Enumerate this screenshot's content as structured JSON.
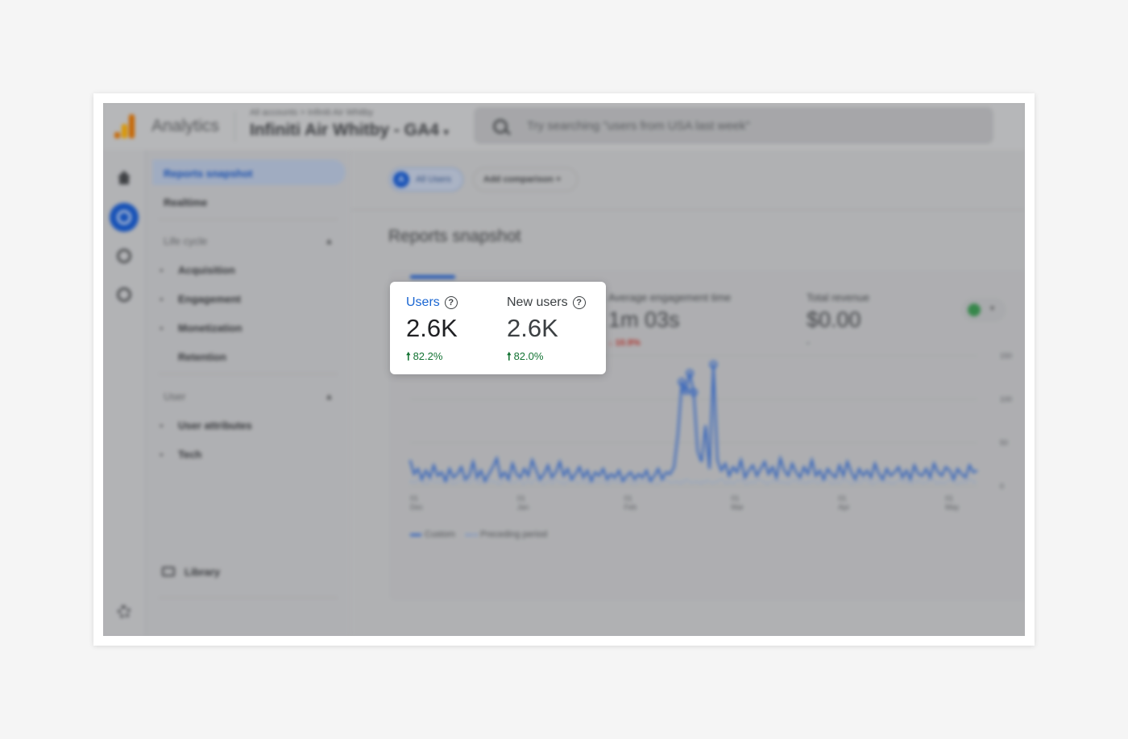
{
  "header": {
    "app_title": "Analytics",
    "breadcrumb": "All accounts > Infiniti Air Whitby",
    "property_name": "Infiniti Air Whitby - GA4",
    "property_caret": "▾",
    "search_placeholder": "Try searching \"users from USA last week\""
  },
  "nav": {
    "reports_snapshot": "Reports snapshot",
    "realtime": "Realtime",
    "lifecycle_section": "Life cycle",
    "lifecycle_items": [
      "Acquisition",
      "Engagement",
      "Monetization",
      "Retention"
    ],
    "user_section": "User",
    "user_items": [
      "User attributes",
      "Tech"
    ],
    "library": "Library",
    "caret_up": "▲",
    "bullet": "▸"
  },
  "filters": {
    "all_users_avatar": "A",
    "all_users": "All Users",
    "add_comparison": "Add comparison +"
  },
  "main": {
    "page_title": "Reports snapshot"
  },
  "metrics": {
    "users": {
      "label": "Users",
      "value": "2.6K",
      "change": "82.2%",
      "direction": "up"
    },
    "new_users": {
      "label": "New users",
      "value": "2.6K",
      "change": "82.0%",
      "direction": "up"
    },
    "engagement": {
      "label": "Average engagement time",
      "value": "1m 03s",
      "change": "↓ 10.9%",
      "direction": "down"
    },
    "revenue": {
      "label": "Total revenue",
      "value": "$0.00",
      "change": "-"
    },
    "help_glyph": "?",
    "up_arrow": "🠕"
  },
  "chart_compare": {
    "caret": "▾"
  },
  "chart_data": {
    "type": "line",
    "x_ticks": [
      "01 Dec",
      "01 Jan",
      "01 Feb",
      "01 Mar",
      "01 Apr",
      "01 May"
    ],
    "y_ticks": [
      0,
      50,
      100,
      150
    ],
    "ylim": [
      0,
      150
    ],
    "grid": true,
    "legend": [
      "Custom",
      "Preceding period"
    ],
    "legend_position": "bottom-left",
    "series": [
      {
        "name": "Custom",
        "values": [
          30,
          14,
          20,
          8,
          18,
          10,
          24,
          12,
          16,
          6,
          20,
          10,
          14,
          22,
          8,
          12,
          28,
          10,
          18,
          6,
          14,
          22,
          32,
          10,
          16,
          8,
          26,
          14,
          10,
          20,
          12,
          30,
          18,
          8,
          14,
          24,
          10,
          16,
          28,
          12,
          20,
          8,
          14,
          22,
          10,
          18,
          6,
          16,
          12,
          20,
          8,
          14,
          10,
          18,
          6,
          12,
          16,
          8,
          14,
          10,
          18,
          6,
          12,
          20,
          8,
          16,
          14,
          22,
          60,
          120,
          110,
          130,
          108,
          40,
          28,
          70,
          20,
          140,
          30,
          18,
          26,
          12,
          22,
          16,
          30,
          10,
          18,
          24,
          12,
          20,
          28,
          14,
          22,
          10,
          32,
          18,
          12,
          26,
          16,
          10,
          22,
          14,
          30,
          12,
          18,
          8,
          20,
          14,
          10,
          24,
          12,
          28,
          16,
          8,
          20,
          12,
          18,
          10,
          26,
          14,
          8,
          20,
          12,
          16,
          22,
          10,
          18,
          8,
          24,
          14,
          12,
          20,
          10,
          26,
          16,
          12,
          22,
          18,
          8,
          20,
          14,
          10,
          24,
          16,
          18
        ]
      },
      {
        "name": "Preceding period",
        "values": [
          6,
          4,
          8,
          5,
          3,
          7,
          5,
          6,
          4,
          8,
          5,
          3,
          6,
          7,
          4,
          5,
          8,
          3,
          6,
          4,
          7,
          5,
          3,
          6,
          8,
          4,
          5,
          7,
          3,
          6,
          4,
          8,
          5,
          3,
          6,
          4,
          7,
          5,
          3,
          6,
          8,
          4,
          5,
          6,
          3,
          7,
          4,
          6,
          5,
          3,
          8,
          4,
          6,
          5,
          7,
          3,
          4,
          6,
          5,
          8,
          4,
          3,
          6,
          7,
          5,
          4,
          6,
          3,
          8,
          5,
          4,
          6,
          3,
          7,
          5,
          4,
          6,
          8,
          3,
          5,
          4,
          7,
          6,
          3,
          5,
          4,
          8,
          6,
          3,
          5,
          7,
          4,
          6,
          3,
          5,
          8,
          4,
          6,
          3,
          7,
          5,
          4,
          6,
          8,
          3,
          5,
          4,
          7,
          6,
          3,
          5,
          4,
          8,
          6,
          3,
          5,
          7,
          4,
          6,
          3,
          5,
          8,
          4,
          6,
          3,
          7,
          5,
          4,
          6,
          8,
          3,
          5,
          4,
          7,
          6,
          3,
          5,
          4,
          8,
          6,
          3
        ]
      }
    ],
    "colors": {
      "custom": "#3d74d8",
      "preceding": "#8fb0e8"
    }
  }
}
